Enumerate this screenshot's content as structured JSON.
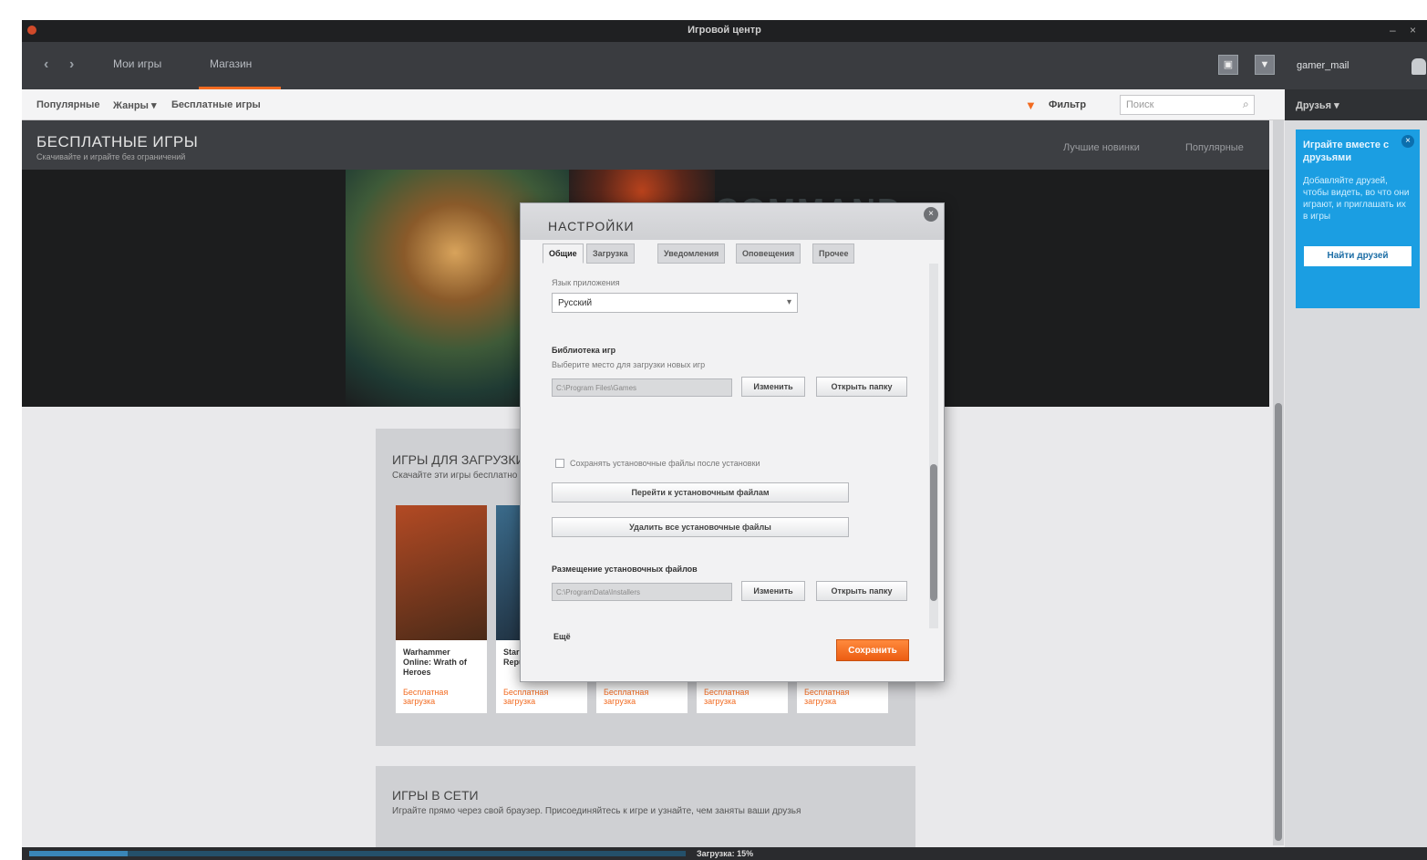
{
  "window": {
    "title": "Игровой центр",
    "minimize": "–",
    "close": "×"
  },
  "nav": {
    "back": "‹",
    "forward": "›",
    "items": [
      "Мои игры",
      "Магазин"
    ],
    "user": "gamer_mail",
    "icon_btn_1": "▣",
    "icon_btn_2": "▼"
  },
  "subbar": {
    "crumbs": [
      "Популярные",
      "Жанры ▾",
      "Бесплатные игры"
    ],
    "filter_label": "Фильтр",
    "search_placeholder": "Поиск"
  },
  "sidebar": {
    "header": "Друзья ▾",
    "promo": {
      "title": "Играйте вместе с друзьями",
      "text": "Добавляйте друзей, чтобы видеть, во что они играют, и приглашать их в игры",
      "button": "Найти друзей",
      "close": "×"
    }
  },
  "hero": {
    "title": "БЕСПЛАТНЫЕ ИГРЫ",
    "subtitle": "Скачивайте и играйте без ограничений",
    "links": [
      "Лучшие новинки",
      "Популярные"
    ],
    "brand": "COMMAND"
  },
  "section1": {
    "title": "ИГРЫ ДЛЯ ЗАГРУЗКИ",
    "subtitle": "Скачайте эти игры бесплатно",
    "cards": [
      {
        "name": "Warhammer Online: Wrath of Heroes",
        "price": "Бесплатная загрузка",
        "color_a": "#b34a24",
        "color_b": "#4a2a18"
      },
      {
        "name": "Star Wars: The Old Republic",
        "price": "Бесплатная загрузка",
        "color_a": "#3a6a8a",
        "color_b": "#1e2c3a"
      },
      {
        "name": "",
        "price": "Бесплатная загрузка",
        "color_a": "#cfd0d3",
        "color_b": "#cfd0d3"
      },
      {
        "name": "",
        "price": "Бесплатная загрузка",
        "color_a": "#cfd0d3",
        "color_b": "#cfd0d3"
      },
      {
        "name": "",
        "price": "Бесплатная загрузка",
        "color_a": "#cfd0d3",
        "color_b": "#cfd0d3"
      }
    ]
  },
  "section2": {
    "title": "ИГРЫ В СЕТИ",
    "subtitle": "Играйте прямо через свой браузер. Присоединяйтесь к игре и узнайте, чем заняты ваши друзья"
  },
  "status": {
    "text": "Загрузка: 15%",
    "progress_percent": 15
  },
  "dialog": {
    "title": "НАСТРОЙКИ",
    "close": "×",
    "tabs": [
      "Общие",
      "Загрузка",
      "Уведомления",
      "Оповещения",
      "Прочее"
    ],
    "language_label": "Язык приложения",
    "language_value": "Русский",
    "lib_header": "Библиотека игр",
    "lib_desc": "Выберите место для загрузки новых игр",
    "lib_path": "C:\\Program Files\\Games",
    "change_btn": "Изменить",
    "open_btn": "Открыть папку",
    "checkbox_label": "Сохранять установочные файлы после установки",
    "move_btn": "Перейти к установочным файлам",
    "delete_btn": "Удалить все установочные файлы",
    "installer_header": "Размещение установочных файлов",
    "installer_path": "C:\\ProgramData\\Installers",
    "change_btn2": "Изменить",
    "open_btn2": "Открыть папку",
    "more_label": "Ещё",
    "save_btn": "Сохранить"
  }
}
